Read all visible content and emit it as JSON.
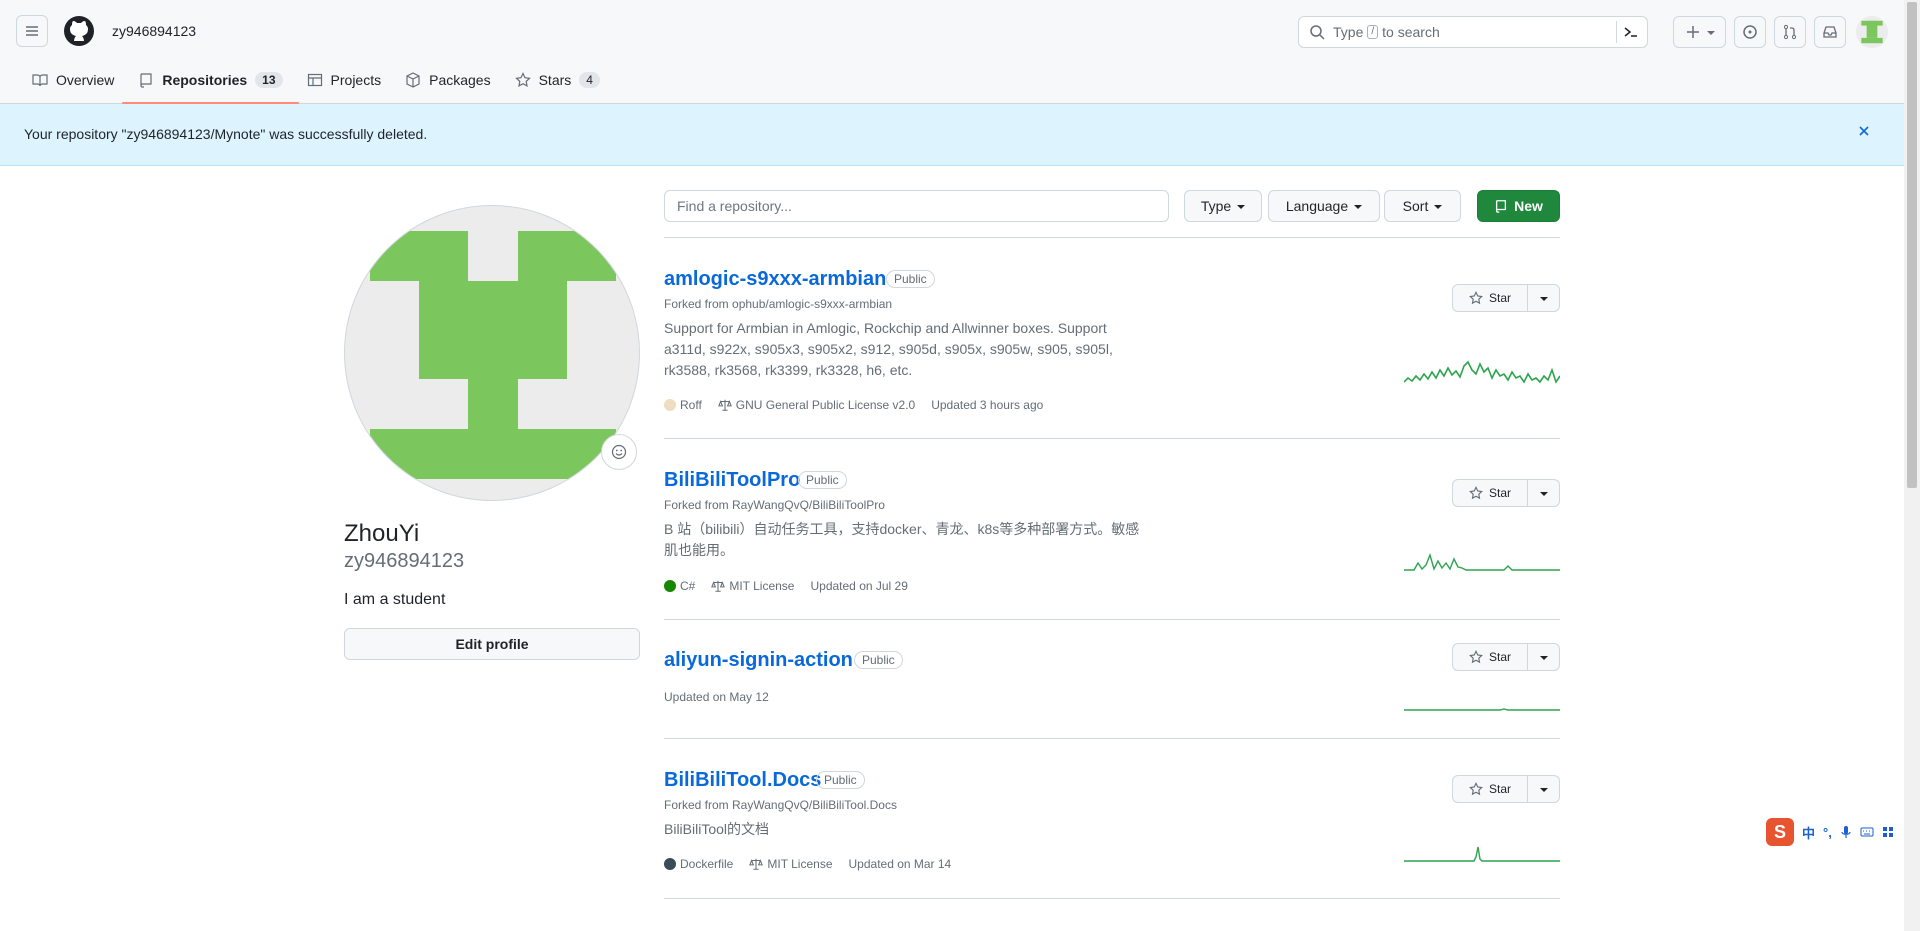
{
  "header": {
    "username": "zy946894123",
    "search_prefix": "Type",
    "search_key": "/",
    "search_suffix": "to search"
  },
  "tabs": [
    {
      "label": "Overview",
      "icon": "book-icon"
    },
    {
      "label": "Repositories",
      "count": "13",
      "icon": "repo-icon"
    },
    {
      "label": "Projects",
      "icon": "table-icon"
    },
    {
      "label": "Packages",
      "icon": "package-icon"
    },
    {
      "label": "Stars",
      "count": "4",
      "icon": "star-icon"
    }
  ],
  "flash": {
    "message": "Your repository \"zy946894123/Mynote\" was successfully deleted."
  },
  "profile": {
    "fullname": "ZhouYi",
    "login": "zy946894123",
    "bio": "I am a student",
    "edit_label": "Edit profile"
  },
  "filters": {
    "search_placeholder": "Find a repository...",
    "type_label": "Type",
    "language_label": "Language",
    "sort_label": "Sort",
    "new_label": "New"
  },
  "repos": [
    {
      "name": "amlogic-s9xxx-armbian",
      "visibility": "Public",
      "fork": "Forked from ophub/amlogic-s9xxx-armbian",
      "description": "Support for Armbian in Amlogic, Rockchip and Allwinner boxes. Support a311d, s922x, s905x3, s905x2, s912, s905d, s905x, s905w, s905, s905l, rk3588, rk3568, rk3399, rk3328, h6, etc.",
      "language": "Roff",
      "language_color": "#ecdebe",
      "license": "GNU General Public License v2.0",
      "updated": "Updated 3 hours ago",
      "star_label": "Star"
    },
    {
      "name": "BiliBiliToolPro",
      "visibility": "Public",
      "fork": "Forked from RayWangQvQ/BiliBiliToolPro",
      "description": "B 站（bilibili）自动任务工具，支持docker、青龙、k8s等多种部署方式。敏感肌也能用。",
      "language": "C#",
      "language_color": "#178600",
      "license": "MIT License",
      "updated": "Updated on Jul 29",
      "star_label": "Star"
    },
    {
      "name": "aliyun-signin-action",
      "visibility": "Public",
      "updated": "Updated on May 12",
      "star_label": "Star"
    },
    {
      "name": "BiliBiliTool.Docs",
      "visibility": "Public",
      "fork": "Forked from RayWangQvQ/BiliBiliTool.Docs",
      "description": "BiliBiliTool的文档",
      "language": "Dockerfile",
      "language_color": "#384d54",
      "license": "MIT License",
      "updated": "Updated on Mar 14",
      "star_label": "Star"
    }
  ],
  "ime": {
    "label": "中",
    "punct": "°,"
  },
  "colors": {
    "accent": "#0969da",
    "primary_button": "#1f883d",
    "flash_bg": "#ddf4ff",
    "tab_underline": "#fd8c73",
    "sparkline": "#2da44e",
    "avatar_green": "#7cc65e"
  }
}
